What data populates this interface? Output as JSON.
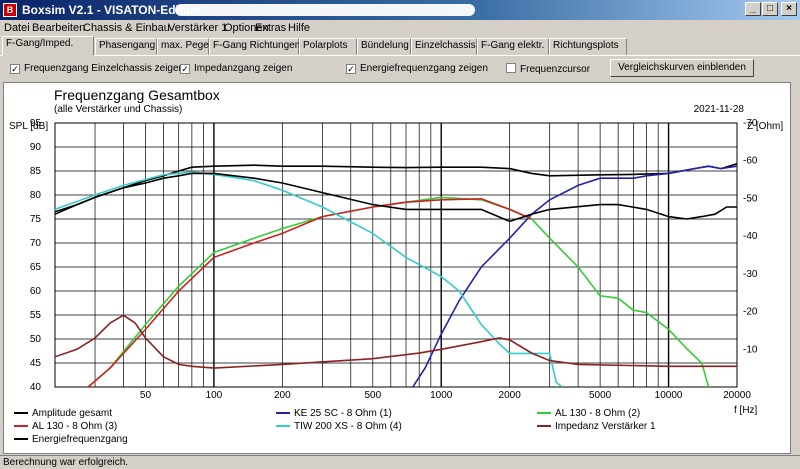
{
  "window": {
    "title": "Boxsim V2.1 - VISATON-Edition",
    "min_label": "_",
    "max_label": "□",
    "close_label": "×"
  },
  "menu": [
    "Datei",
    "Bearbeiten",
    "Chassis & Einbau",
    "Verstärker 1",
    "Optionen",
    "Extras",
    "Hilfe"
  ],
  "tabs": [
    "F-Gang/Imped.",
    "Phasengang",
    "max. Pegel",
    "F-Gang Richtungen",
    "Polarplots",
    "Bündelung",
    "Einzelchassis",
    "F-Gang elektr.",
    "Richtungsplots"
  ],
  "options": {
    "checkboxes": [
      {
        "label": "Frequenzgang Einzelchassis zeigen",
        "checked": true
      },
      {
        "label": "Impedanzgang zeigen",
        "checked": true
      },
      {
        "label": "Energiefrequenzgang zeigen",
        "checked": true
      },
      {
        "label": "Frequenzcursor",
        "checked": false
      }
    ],
    "compare_button": "Vergleichskurven einblenden"
  },
  "status": "Berechnung war erfolgreich.",
  "chart_data": {
    "type": "line",
    "title": "Frequenzgang Gesamtbox",
    "subtitle": "(alle Verstärker und Chassis)",
    "date": "2021-11-28",
    "xlabel": "f [Hz]",
    "ylabel": "SPL [dB]",
    "y2label": "Z [Ohm]",
    "xscale": "log",
    "xlim": [
      20,
      20000
    ],
    "ylim": [
      40,
      95
    ],
    "y2lim": [
      0,
      70
    ],
    "x_ticks": [
      50,
      100,
      200,
      500,
      1000,
      2000,
      5000,
      10000,
      20000
    ],
    "y_ticks": [
      40,
      45,
      50,
      55,
      60,
      65,
      70,
      75,
      80,
      85,
      90,
      95
    ],
    "y2_ticks": [
      10,
      20,
      30,
      40,
      50,
      60,
      70
    ],
    "grid": true,
    "series": [
      {
        "name": "Amplitude gesamt",
        "color": "#000000",
        "axis": "left",
        "points": [
          [
            20,
            76
          ],
          [
            25,
            78
          ],
          [
            30,
            79.5
          ],
          [
            40,
            81.5
          ],
          [
            50,
            83
          ],
          [
            60,
            84
          ],
          [
            70,
            85
          ],
          [
            80,
            85.8
          ],
          [
            100,
            86
          ],
          [
            150,
            86.2
          ],
          [
            200,
            86
          ],
          [
            300,
            86
          ],
          [
            500,
            85.8
          ],
          [
            700,
            85.7
          ],
          [
            1000,
            85.8
          ],
          [
            1500,
            85.8
          ],
          [
            2000,
            85.5
          ],
          [
            2500,
            84.5
          ],
          [
            3000,
            84
          ],
          [
            5000,
            84.2
          ],
          [
            7000,
            84.3
          ],
          [
            10000,
            84.5
          ],
          [
            13000,
            85.5
          ],
          [
            15000,
            86
          ],
          [
            17000,
            85.5
          ],
          [
            20000,
            86.5
          ]
        ]
      },
      {
        "name": "KE 25 SC - 8 Ohm   (1)",
        "color": "#2222aa",
        "axis": "left",
        "points": [
          [
            750,
            40
          ],
          [
            850,
            44
          ],
          [
            1000,
            51
          ],
          [
            1200,
            58
          ],
          [
            1500,
            65
          ],
          [
            2000,
            71
          ],
          [
            2500,
            76
          ],
          [
            3000,
            79
          ],
          [
            4000,
            82
          ],
          [
            5000,
            83.5
          ],
          [
            6000,
            83.5
          ],
          [
            7000,
            83.5
          ],
          [
            8000,
            84
          ],
          [
            10000,
            84.5
          ],
          [
            13000,
            85.5
          ],
          [
            15000,
            86
          ],
          [
            17000,
            85.5
          ],
          [
            20000,
            86
          ]
        ]
      },
      {
        "name": "AL 130 - 8 Ohm (2)",
        "color": "#33cc33",
        "axis": "left",
        "points": [
          [
            28,
            40
          ],
          [
            35,
            44
          ],
          [
            50,
            53
          ],
          [
            70,
            61
          ],
          [
            100,
            68
          ],
          [
            150,
            71
          ],
          [
            200,
            73
          ],
          [
            300,
            75.5
          ],
          [
            500,
            77.5
          ],
          [
            700,
            78.5
          ],
          [
            1000,
            79.5
          ],
          [
            1500,
            79
          ],
          [
            2000,
            77
          ],
          [
            2500,
            75
          ],
          [
            3000,
            71
          ],
          [
            4000,
            65
          ],
          [
            5000,
            59
          ],
          [
            6000,
            58.5
          ],
          [
            7000,
            56
          ],
          [
            8000,
            55.5
          ],
          [
            10000,
            52
          ],
          [
            12000,
            48
          ],
          [
            14000,
            45
          ],
          [
            15000,
            40
          ]
        ]
      },
      {
        "name": "AL 130 - 8 Ohm (3)",
        "color": "#cc2222",
        "axis": "left",
        "points": [
          [
            28,
            40
          ],
          [
            35,
            44
          ],
          [
            50,
            52
          ],
          [
            70,
            60
          ],
          [
            100,
            67
          ],
          [
            150,
            70
          ],
          [
            200,
            72
          ],
          [
            300,
            75.5
          ],
          [
            500,
            77.5
          ],
          [
            700,
            78.5
          ],
          [
            1000,
            79
          ],
          [
            1500,
            79.2
          ],
          [
            2000,
            77
          ],
          [
            2500,
            75
          ]
        ]
      },
      {
        "name": "TIW 200 XS - 8 Ohm (4)",
        "color": "#33cccc",
        "axis": "left",
        "points": [
          [
            20,
            77
          ],
          [
            30,
            80
          ],
          [
            40,
            82
          ],
          [
            60,
            84.2
          ],
          [
            80,
            84.8
          ],
          [
            100,
            84.3
          ],
          [
            150,
            83
          ],
          [
            200,
            81
          ],
          [
            300,
            77.5
          ],
          [
            500,
            72
          ],
          [
            700,
            67
          ],
          [
            1000,
            63
          ],
          [
            1200,
            60
          ],
          [
            1500,
            53
          ],
          [
            1800,
            49
          ],
          [
            2000,
            47
          ],
          [
            2500,
            47
          ],
          [
            3000,
            47
          ],
          [
            3200,
            41
          ],
          [
            3400,
            40
          ]
        ]
      },
      {
        "name": "Impedanz Verstärker 1",
        "color": "#8b2222",
        "axis": "right",
        "points": [
          [
            20,
            8
          ],
          [
            25,
            10
          ],
          [
            30,
            13
          ],
          [
            35,
            17
          ],
          [
            40,
            19
          ],
          [
            45,
            17
          ],
          [
            50,
            13
          ],
          [
            60,
            8
          ],
          [
            70,
            6
          ],
          [
            80,
            5.5
          ],
          [
            100,
            5
          ],
          [
            200,
            6
          ],
          [
            500,
            7.5
          ],
          [
            800,
            9
          ],
          [
            1000,
            10
          ],
          [
            1500,
            12
          ],
          [
            1800,
            13
          ],
          [
            2000,
            12.5
          ],
          [
            2500,
            9
          ],
          [
            3000,
            7
          ],
          [
            4000,
            6
          ],
          [
            10000,
            5.5
          ],
          [
            20000,
            5.5
          ]
        ]
      },
      {
        "name": "Energiefrequenzgang",
        "color": "#000000",
        "axis": "left",
        "points": [
          [
            20,
            76.5
          ],
          [
            25,
            78
          ],
          [
            30,
            79.5
          ],
          [
            40,
            81.5
          ],
          [
            50,
            82.5
          ],
          [
            60,
            83.5
          ],
          [
            70,
            84
          ],
          [
            80,
            84.5
          ],
          [
            100,
            84.5
          ],
          [
            150,
            83.5
          ],
          [
            200,
            82.5
          ],
          [
            300,
            80.5
          ],
          [
            500,
            78
          ],
          [
            700,
            77
          ],
          [
            1000,
            77
          ],
          [
            1500,
            77
          ],
          [
            2000,
            74.5
          ],
          [
            2500,
            76
          ],
          [
            3000,
            77
          ],
          [
            5000,
            78
          ],
          [
            6000,
            78
          ],
          [
            8000,
            77
          ],
          [
            10000,
            75.5
          ],
          [
            12000,
            75
          ],
          [
            14000,
            75.5
          ],
          [
            16000,
            76
          ],
          [
            18000,
            77.5
          ],
          [
            20000,
            77.5
          ]
        ]
      }
    ]
  }
}
